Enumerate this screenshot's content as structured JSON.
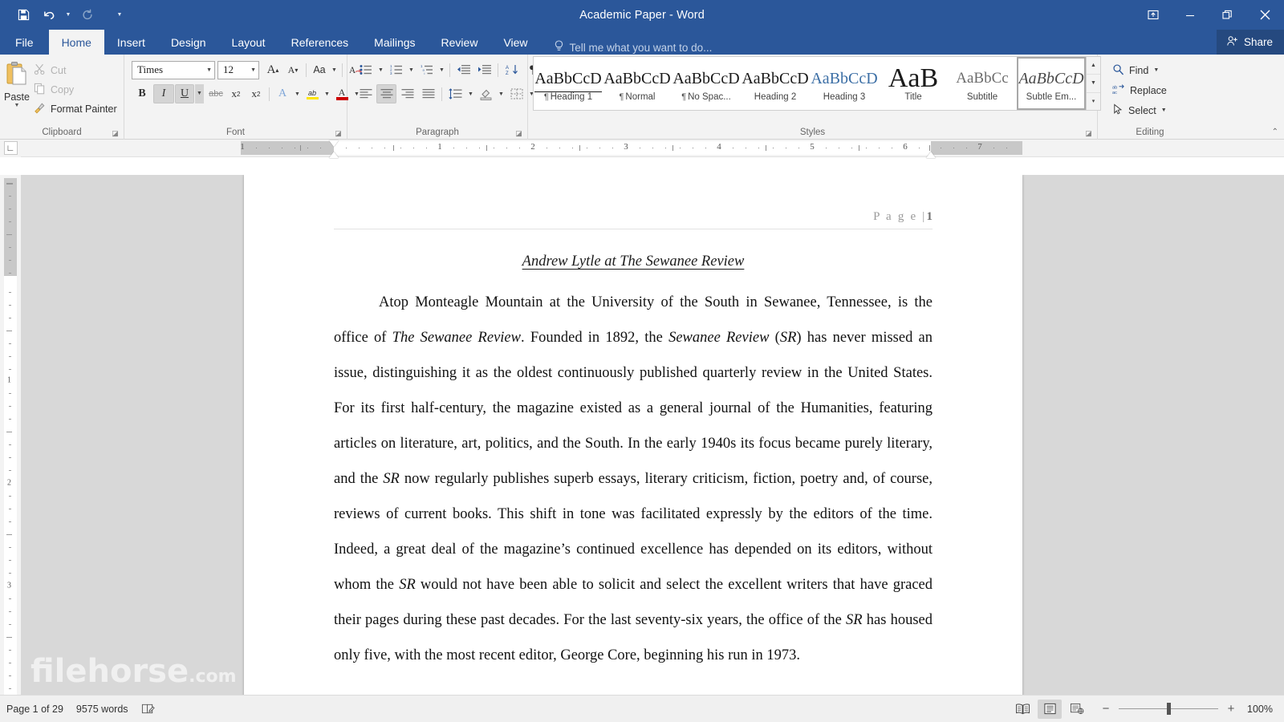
{
  "titlebar": {
    "title": "Academic Paper - Word",
    "qat": [
      {
        "name": "save",
        "label": "Save"
      },
      {
        "name": "undo",
        "label": "Undo"
      },
      {
        "name": "redo",
        "label": "Redo"
      },
      {
        "name": "customize",
        "label": "Customize Quick Access Toolbar"
      }
    ],
    "window_controls": [
      {
        "name": "ribbon-display-options",
        "label": "Ribbon Display Options"
      },
      {
        "name": "minimize",
        "label": "Minimize"
      },
      {
        "name": "restore",
        "label": "Restore Down"
      },
      {
        "name": "close",
        "label": "Close"
      }
    ]
  },
  "tabs": [
    {
      "label": "File",
      "active": false
    },
    {
      "label": "Home",
      "active": true
    },
    {
      "label": "Insert",
      "active": false
    },
    {
      "label": "Design",
      "active": false
    },
    {
      "label": "Layout",
      "active": false
    },
    {
      "label": "References",
      "active": false
    },
    {
      "label": "Mailings",
      "active": false
    },
    {
      "label": "Review",
      "active": false
    },
    {
      "label": "View",
      "active": false
    }
  ],
  "tellme": {
    "placeholder": "Tell me what you want to do...",
    "icon": "lightbulb-icon"
  },
  "share": {
    "label": "Share",
    "icon": "person-add-icon"
  },
  "ribbon": {
    "clipboard": {
      "group_label": "Clipboard",
      "paste_label": "Paste",
      "commands": [
        {
          "label": "Cut",
          "icon": "scissors-icon",
          "enabled": false
        },
        {
          "label": "Copy",
          "icon": "copy-icon",
          "enabled": false
        },
        {
          "label": "Format Painter",
          "icon": "paintbrush-icon",
          "enabled": true
        }
      ]
    },
    "font": {
      "group_label": "Font",
      "font_name": "Times",
      "font_size": "12",
      "buttons_row1": [
        {
          "name": "grow-font",
          "glyph": "A"
        },
        {
          "name": "shrink-font",
          "glyph": "A"
        },
        {
          "name": "change-case",
          "glyph": "Aa"
        },
        {
          "name": "clear-formatting",
          "glyph": "A"
        }
      ],
      "buttons_row2": [
        {
          "name": "bold",
          "glyph": "B",
          "active": false
        },
        {
          "name": "italic",
          "glyph": "I",
          "active": true
        },
        {
          "name": "underline",
          "glyph": "U",
          "active": true
        },
        {
          "name": "strikethrough",
          "glyph": "abc",
          "active": false
        },
        {
          "name": "subscript",
          "glyph": "x",
          "sup": "2",
          "active": false
        },
        {
          "name": "superscript",
          "glyph": "x",
          "sup": "2",
          "active": false
        },
        {
          "name": "text-effects",
          "glyph": "A",
          "active": false
        },
        {
          "name": "text-highlight-color",
          "glyph": "ab",
          "active": false
        },
        {
          "name": "font-color",
          "glyph": "A",
          "active": false
        }
      ]
    },
    "paragraph": {
      "group_label": "Paragraph",
      "row1": [
        {
          "name": "bullets"
        },
        {
          "name": "numbering"
        },
        {
          "name": "multilevel-list"
        },
        {
          "name": "decrease-indent"
        },
        {
          "name": "increase-indent"
        },
        {
          "name": "sort"
        },
        {
          "name": "show-formatting-marks"
        }
      ],
      "row2": [
        {
          "name": "align-left",
          "active": false
        },
        {
          "name": "align-center",
          "active": true
        },
        {
          "name": "align-right",
          "active": false
        },
        {
          "name": "justify",
          "active": false
        },
        {
          "name": "line-spacing"
        },
        {
          "name": "shading"
        },
        {
          "name": "borders"
        }
      ]
    },
    "styles": {
      "group_label": "Styles",
      "items": [
        {
          "preview": "AaBbCcD",
          "name": "Heading 1",
          "pilcrow": true,
          "variant": "h1",
          "selected": false
        },
        {
          "preview": "AaBbCcD",
          "name": "Normal",
          "pilcrow": true,
          "variant": "normal",
          "selected": false
        },
        {
          "preview": "AaBbCcD",
          "name": "No Spac...",
          "pilcrow": true,
          "variant": "normal",
          "selected": false
        },
        {
          "preview": "AaBbCcD",
          "name": "Heading 2",
          "pilcrow": false,
          "variant": "normal",
          "selected": false
        },
        {
          "preview": "AaBbCcD",
          "name": "Heading 3",
          "pilcrow": false,
          "variant": "h3",
          "selected": false
        },
        {
          "preview": "AaB",
          "name": "Title",
          "pilcrow": false,
          "variant": "title",
          "selected": false
        },
        {
          "preview": "AaBbCc",
          "name": "Subtitle",
          "pilcrow": false,
          "variant": "subtitle",
          "selected": false
        },
        {
          "preview": "AaBbCcD",
          "name": "Subtle Em...",
          "pilcrow": false,
          "variant": "emphasis",
          "selected": true
        }
      ]
    },
    "editing": {
      "group_label": "Editing",
      "items": [
        {
          "label": "Find",
          "icon": "magnifier-icon",
          "caret": true
        },
        {
          "label": "Replace",
          "icon": "replace-icon",
          "caret": false
        },
        {
          "label": "Select",
          "icon": "cursor-arrow-icon",
          "caret": true
        }
      ]
    }
  },
  "ruler": {
    "horizontal_numbers": [
      "1",
      "1",
      "2",
      "3",
      "4",
      "5",
      "6",
      "7"
    ],
    "vertical_numbers": [
      "1",
      "2",
      "3"
    ],
    "tab_stop_selector": "left-tab-icon"
  },
  "document": {
    "header_page_label": "P a g e  |",
    "header_page_number": "1",
    "title": "Andrew Lytle at The Sewanee Review",
    "paragraph": [
      {
        "t": "Atop Monteagle Mountain at the University of the South in Sewanee, Tennessee, is the office of ",
        "i": false
      },
      {
        "t": "The Sewanee Review",
        "i": true
      },
      {
        "t": ". Founded in 1892, the ",
        "i": false
      },
      {
        "t": "Sewanee Review",
        "i": true
      },
      {
        "t": " (",
        "i": false
      },
      {
        "t": "SR",
        "i": true
      },
      {
        "t": ") has never missed an issue, distinguishing it as the oldest continuously published quarterly review in the United States. For its first half-century, the magazine existed as a general journal of the Humanities, featuring articles on literature, art, politics, and the South. In the early 1940s its focus became purely literary, and the ",
        "i": false
      },
      {
        "t": "SR",
        "i": true
      },
      {
        "t": " now regularly publishes superb essays, literary criticism, fiction, poetry and, of course, reviews of current books. This shift in tone was facilitated expressly by the editors of the time. Indeed, a great deal of the magazine’s continued excellence has depended on its editors, without whom the ",
        "i": false
      },
      {
        "t": "SR",
        "i": true
      },
      {
        "t": " would not have been able to solicit and select the excellent writers that have graced their pages during these past decades. For the last seventy-six years, the office of the ",
        "i": false
      },
      {
        "t": "SR",
        "i": true
      },
      {
        "t": " has housed only five, with the most recent editor, George Core, beginning his run in 1973.",
        "i": false
      }
    ]
  },
  "watermark": {
    "main": "filehorse",
    "suffix": ".com"
  },
  "statusbar": {
    "page_info": "Page 1 of 29",
    "word_count": "9575 words",
    "proofing_icon": "proofing-errors-icon",
    "views": [
      {
        "name": "read-mode",
        "active": false
      },
      {
        "name": "print-layout",
        "active": true
      },
      {
        "name": "web-layout",
        "active": false
      }
    ],
    "zoom_out": "−",
    "zoom_in": "+",
    "zoom_level": "100%"
  }
}
